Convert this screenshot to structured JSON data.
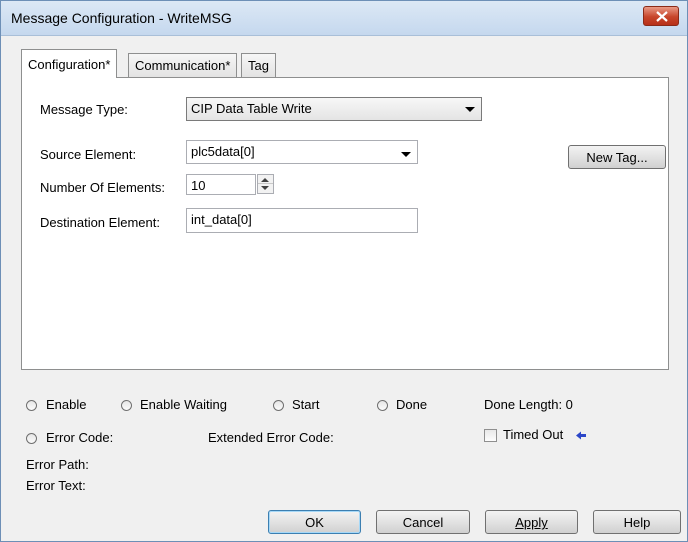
{
  "window": {
    "title": "Message Configuration - WriteMSG",
    "close_icon": "close-icon"
  },
  "tabs": [
    {
      "label": "Configuration*",
      "active": true
    },
    {
      "label": "Communication*",
      "active": false
    },
    {
      "label": "Tag",
      "active": false
    }
  ],
  "config": {
    "message_type_label": "Message Type:",
    "message_type_value": "CIP Data Table Write",
    "source_label": "Source Element:",
    "source_value": "plc5data[0]",
    "num_elements_label": "Number Of Elements:",
    "num_elements_value": "10",
    "dest_label": "Destination Element:",
    "dest_value": "int_data[0]",
    "new_tag_button": "New Tag..."
  },
  "status": {
    "enable": "Enable",
    "enable_waiting": "Enable Waiting",
    "start": "Start",
    "done": "Done",
    "done_length": "Done Length: 0",
    "error_code": "Error Code:",
    "extended_error_code": "Extended Error Code:",
    "timed_out": "Timed Out",
    "timed_out_checked": false,
    "error_path": "Error Path:",
    "error_text": "Error Text:"
  },
  "buttons": {
    "ok": "OK",
    "cancel": "Cancel",
    "apply": "Apply",
    "help": "Help"
  },
  "colors": {
    "close_button": "#c7452a",
    "arrow_indicator": "#2b46c8"
  }
}
